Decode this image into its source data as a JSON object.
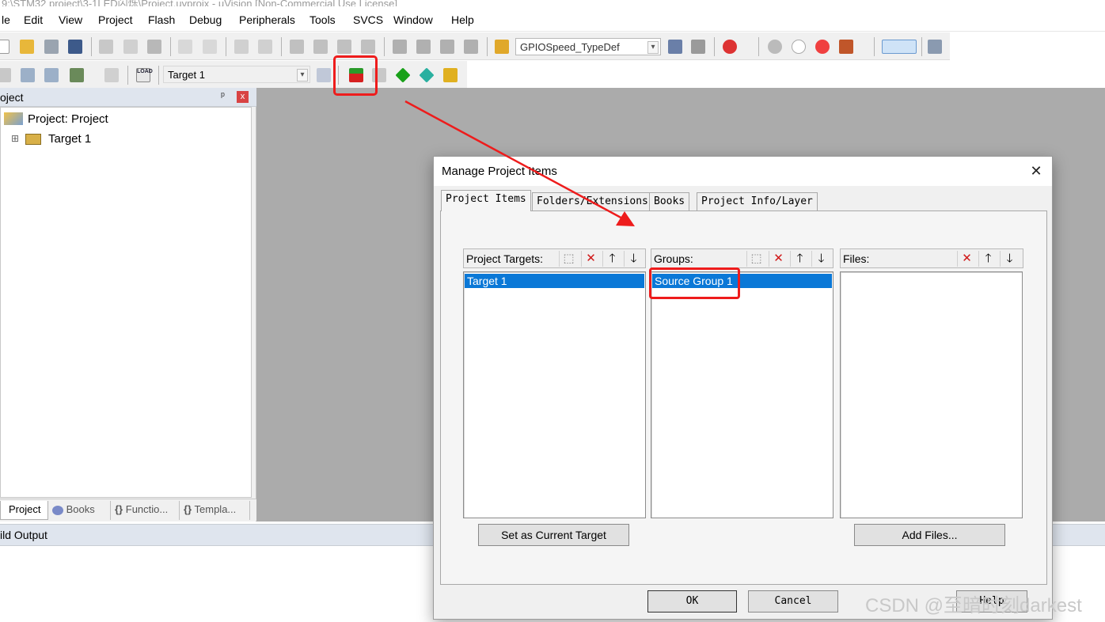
{
  "window_title": "9:\\STM32 project\\3-1LED闪烁\\Project.uvprojx - µVision  [Non-Commercial Use License]",
  "menu": [
    "le",
    "Edit",
    "View",
    "Project",
    "Flash",
    "Debug",
    "Peripherals",
    "Tools",
    "SVCS",
    "Window",
    "Help"
  ],
  "toolbar": {
    "find_combo_value": "GPIOSpeed_TypeDef",
    "target_combo_value": "Target 1",
    "load_label": "LOAD"
  },
  "project_panel": {
    "header": "oject",
    "pin_glyph": "ᵖ",
    "close_glyph": "x",
    "tree": [
      {
        "label": "Project: Project",
        "expander": ""
      },
      {
        "label": "Target 1",
        "expander": "⊞"
      }
    ],
    "tabs": [
      "Project",
      "Books",
      "Functio...",
      "Templa..."
    ],
    "tab_icons": [
      "{}",
      "{}"
    ]
  },
  "build_output": {
    "label": "ild Output"
  },
  "dialog": {
    "title": "Manage Project Items",
    "close_glyph": "✕",
    "tabs": [
      "Project Items",
      "Folders/Extensions",
      "Books",
      "Project Info/Layer"
    ],
    "targets": {
      "header": "Project Targets:",
      "items": [
        "Target 1"
      ],
      "selected": "Target 1"
    },
    "groups": {
      "header": "Groups:",
      "items": [
        "Source Group 1"
      ],
      "selected": "Source Group 1"
    },
    "files": {
      "header": "Files:",
      "items": []
    },
    "header_buttons": {
      "new": "⬚",
      "delete": "✕",
      "up": "🡑",
      "down": "🡓"
    },
    "set_current_button": "Set as Current Target",
    "add_files_button": "Add Files...",
    "ok_button": "OK",
    "cancel_button": "Cancel",
    "help_button": "Help"
  },
  "annotation": {
    "color": "#ee1c1c"
  },
  "watermark": "CSDN @至暗时刻darkest"
}
